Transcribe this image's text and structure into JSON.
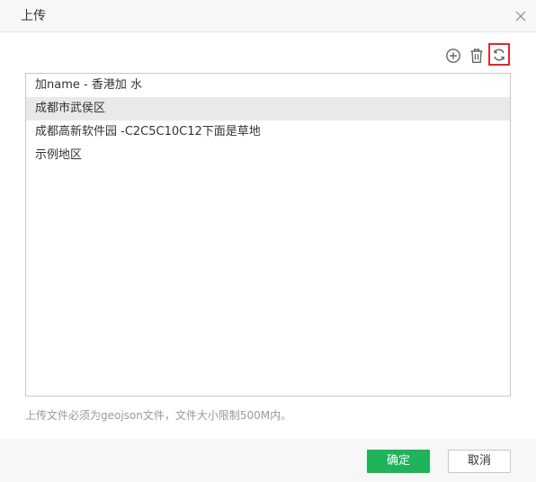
{
  "dialog": {
    "title": "上传",
    "close_icon": "close-icon"
  },
  "toolbar": {
    "add_icon": "plus-circle-icon",
    "delete_icon": "trash-icon",
    "refresh_icon": "refresh-icon",
    "refresh_highlight_color": "#e3262b"
  },
  "list": {
    "items": [
      {
        "label": "加name - 香港加 水",
        "selected": false
      },
      {
        "label": "成都市武侯区",
        "selected": true
      },
      {
        "label": "成都高新软件园 -C2C5C10C12下面是草地",
        "selected": false
      },
      {
        "label": "示例地区",
        "selected": false
      }
    ]
  },
  "hint": "上传文件必须为geojson文件，文件大小限制500M内。",
  "footer": {
    "ok_label": "确定",
    "cancel_label": "取消",
    "ok_color": "#1fb35a"
  }
}
